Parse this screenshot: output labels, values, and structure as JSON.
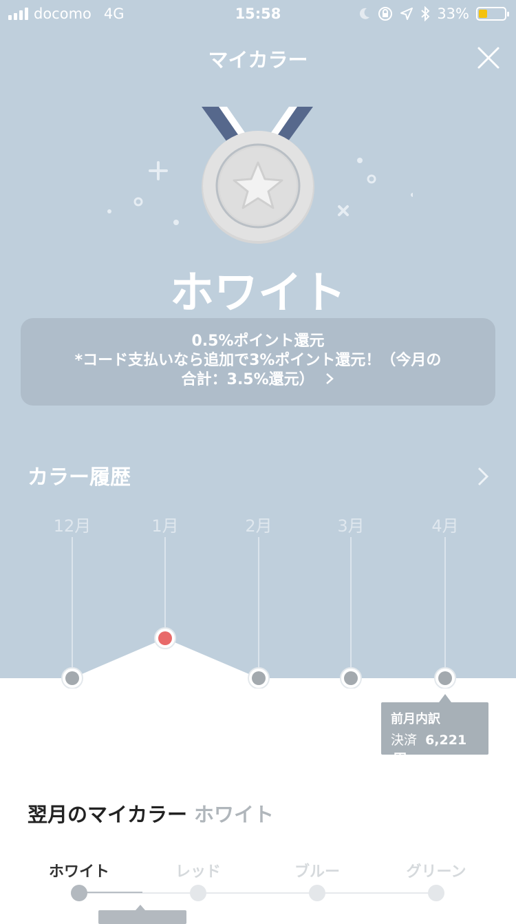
{
  "status_bar": {
    "carrier": "docomo",
    "network": "4G",
    "time": "15:58",
    "battery": "33%",
    "battery_level": 0.33,
    "icons": [
      "signal-icon",
      "moon-icon",
      "rotation-lock-icon",
      "location-icon",
      "bluetooth-icon",
      "battery-icon"
    ]
  },
  "header": {
    "title": "マイカラー",
    "close_icon": "close-icon"
  },
  "medal": {
    "icon": "medal-star-icon",
    "rank_name": "ホワイト"
  },
  "info": {
    "line1": "0.5%ポイント還元",
    "line2": "*コード支払いなら追加で3%ポイント還元！（今月の",
    "line3": "合計：3.5%還元）",
    "arrow_icon": "chevron-right-icon"
  },
  "history": {
    "title": "カラー履歴",
    "arrow_icon": "chevron-right-icon"
  },
  "chart_data": {
    "type": "line",
    "categories": [
      "12月",
      "1月",
      "2月",
      "3月",
      "4月"
    ],
    "values": [
      0,
      1,
      0,
      0,
      0
    ],
    "point_colors": [
      "#a3a9ae",
      "#e86a6a",
      "#a3a9ae",
      "#a3a9ae",
      "#a3a9ae"
    ],
    "highlight_index": 4
  },
  "tooltip": {
    "title": "前月内訳",
    "label": "決済",
    "value": "6,221",
    "unit": "円"
  },
  "next_month": {
    "label": "翌月のマイカラー",
    "color": "ホワイト"
  },
  "tabs": {
    "items": [
      {
        "label": "ホワイト",
        "active": true
      },
      {
        "label": "レッド",
        "active": false
      },
      {
        "label": "ブルー",
        "active": false
      },
      {
        "label": "グリーン",
        "active": false
      }
    ]
  },
  "colors": {
    "background": "#bfcfdc",
    "info_box": "#afbdca",
    "point_red": "#e86a6a",
    "point_grey": "#a3a9ae",
    "battery": "#f4c20d"
  }
}
